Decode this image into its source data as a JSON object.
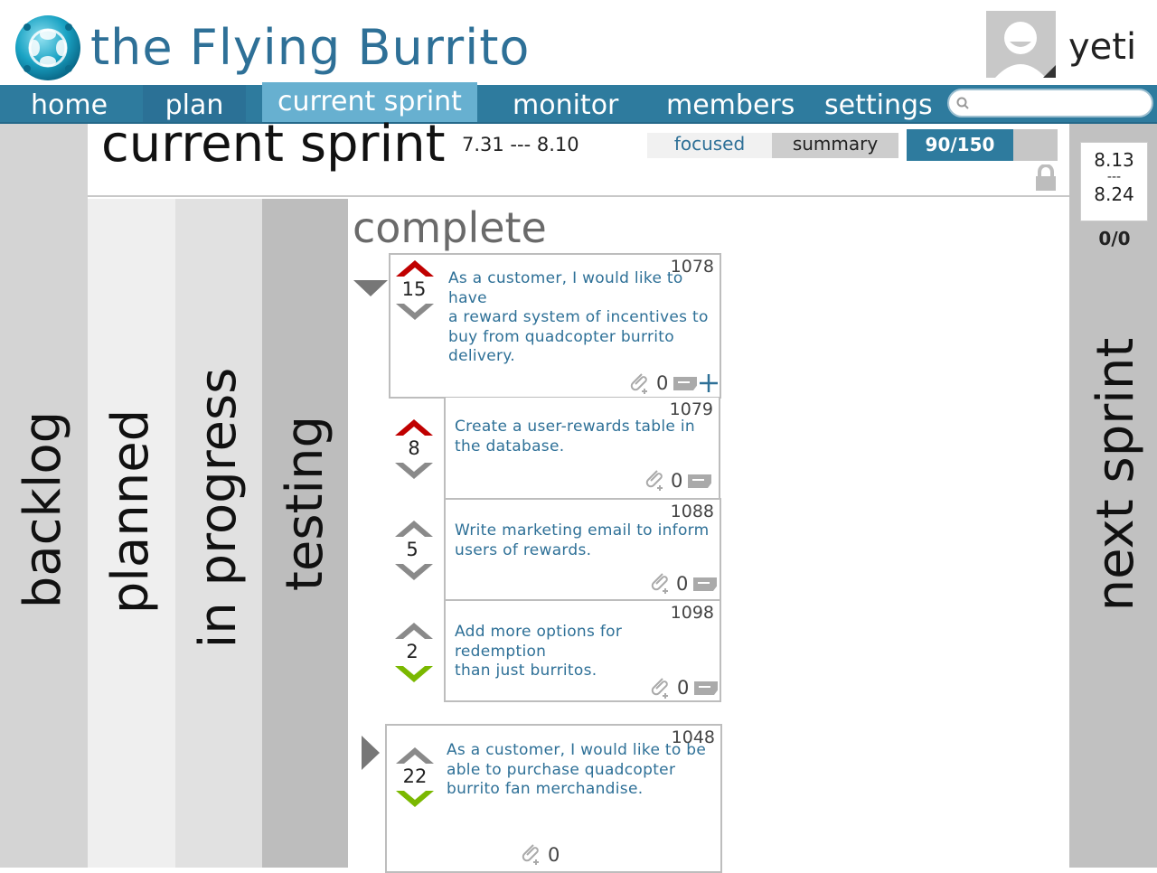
{
  "header": {
    "app_title": "the Flying Burrito",
    "username": "yeti"
  },
  "nav": {
    "items": [
      {
        "label": "home"
      },
      {
        "label": "plan"
      },
      {
        "label": "current sprint",
        "active": true
      },
      {
        "label": "monitor"
      },
      {
        "label": "members"
      },
      {
        "label": "settings"
      }
    ],
    "search_placeholder": ""
  },
  "columns": {
    "backlog": "backlog",
    "planned": "planned",
    "in_progress": "in progress",
    "testing": "testing",
    "next_sprint": "next sprint"
  },
  "sprint": {
    "title": "current sprint",
    "dates": "7.31 --- 8.10",
    "tab_focused": "focused",
    "tab_summary": "summary",
    "progress_label": "90/150",
    "progress_fraction": 0.6
  },
  "next_sprint_card": {
    "start": "8.13",
    "separator": "---",
    "end": "8.24",
    "points": "0/0"
  },
  "complete": {
    "heading": "complete",
    "stories": [
      {
        "id": "1078",
        "points": "15",
        "collapsed": false,
        "text": [
          "As a customer, I would like to have",
          "a reward system of  incentives to",
          "buy from quadcopter burrito",
          "delivery."
        ],
        "attachments": "0",
        "tasks": [
          {
            "id": "1079",
            "points": "8",
            "text": [
              "Create a user-rewards table in",
              "the database."
            ],
            "attachments": "0"
          },
          {
            "id": "1088",
            "points": "5",
            "text": [
              "Write marketing email to inform",
              "users of  rewards."
            ],
            "attachments": "0"
          },
          {
            "id": "1098",
            "points": "2",
            "text": [
              "Add more options for redemption",
              "than just burritos."
            ],
            "attachments": "0"
          }
        ]
      },
      {
        "id": "1048",
        "points": "22",
        "collapsed": true,
        "text": [
          "As a customer, I would like to be",
          "able to purchase quadcopter",
          "burrito fan merchandise."
        ],
        "attachments": "0"
      }
    ]
  },
  "colors": {
    "brand_blue": "#2e7097",
    "nav_bar": "#2e7b9e",
    "nav_active": "#67b0d0",
    "vote_up_red": "#c00000",
    "vote_down_green": "#7ab800",
    "vote_neutral": "#8a8a8a"
  }
}
